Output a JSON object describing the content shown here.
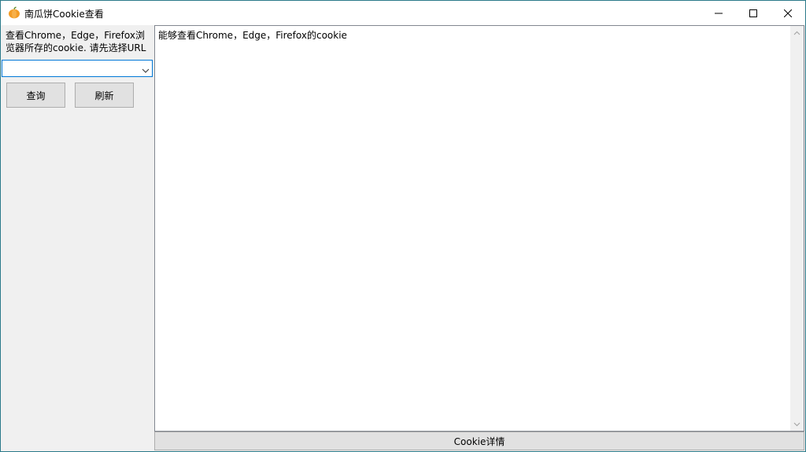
{
  "window": {
    "title": "南瓜饼Cookie查看",
    "icon": "pumpkin-icon",
    "controls": [
      "minimize-icon",
      "maximize-icon",
      "close-icon"
    ]
  },
  "left_panel": {
    "description": "查看Chrome，Edge，Firefox浏览器所存的cookie. 请先选择URL",
    "url_select": {
      "value": "",
      "options": []
    },
    "query_label": "查询",
    "refresh_label": "刷新"
  },
  "content": {
    "text": "能够查看Chrome，Edge，Firefox的cookie"
  },
  "status_bar": {
    "label": "Cookie详情"
  },
  "colors": {
    "accent": "#0078d7",
    "window_bg": "#f0f0f0",
    "button_bg": "#e1e1e1",
    "pumpkin": "#f5a623"
  }
}
